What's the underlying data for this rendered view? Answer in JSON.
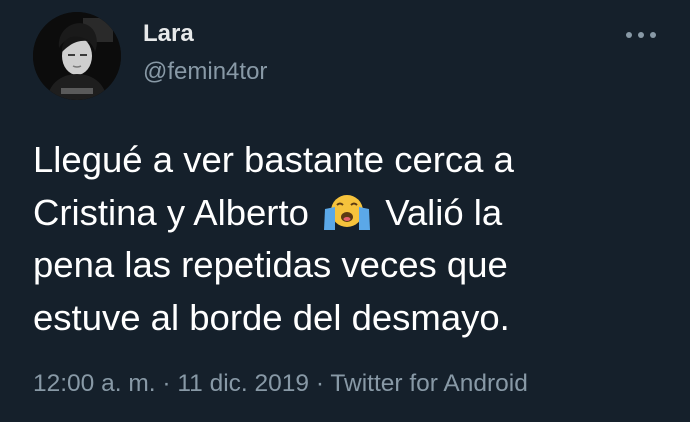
{
  "user": {
    "display_name": "Lara",
    "handle": "@femin4tor",
    "avatar_icon": "profile-photo"
  },
  "menu": {
    "icon": "more-horizontal-icon"
  },
  "tweet": {
    "text_lines": [
      "Llegué a ver bastante cerca a",
      "Cristina y Alberto",
      "Valió la",
      "pena las repetidas veces que",
      "estuve al borde del desmayo."
    ],
    "emoji": "loudly-crying-face"
  },
  "meta": {
    "time": "12:00 a. m.",
    "separator": "·",
    "date": "11 dic. 2019",
    "source": "Twitter for Android"
  },
  "colors": {
    "background": "#15202b",
    "primary_text": "#ffffff",
    "secondary_text": "#8899a6"
  }
}
